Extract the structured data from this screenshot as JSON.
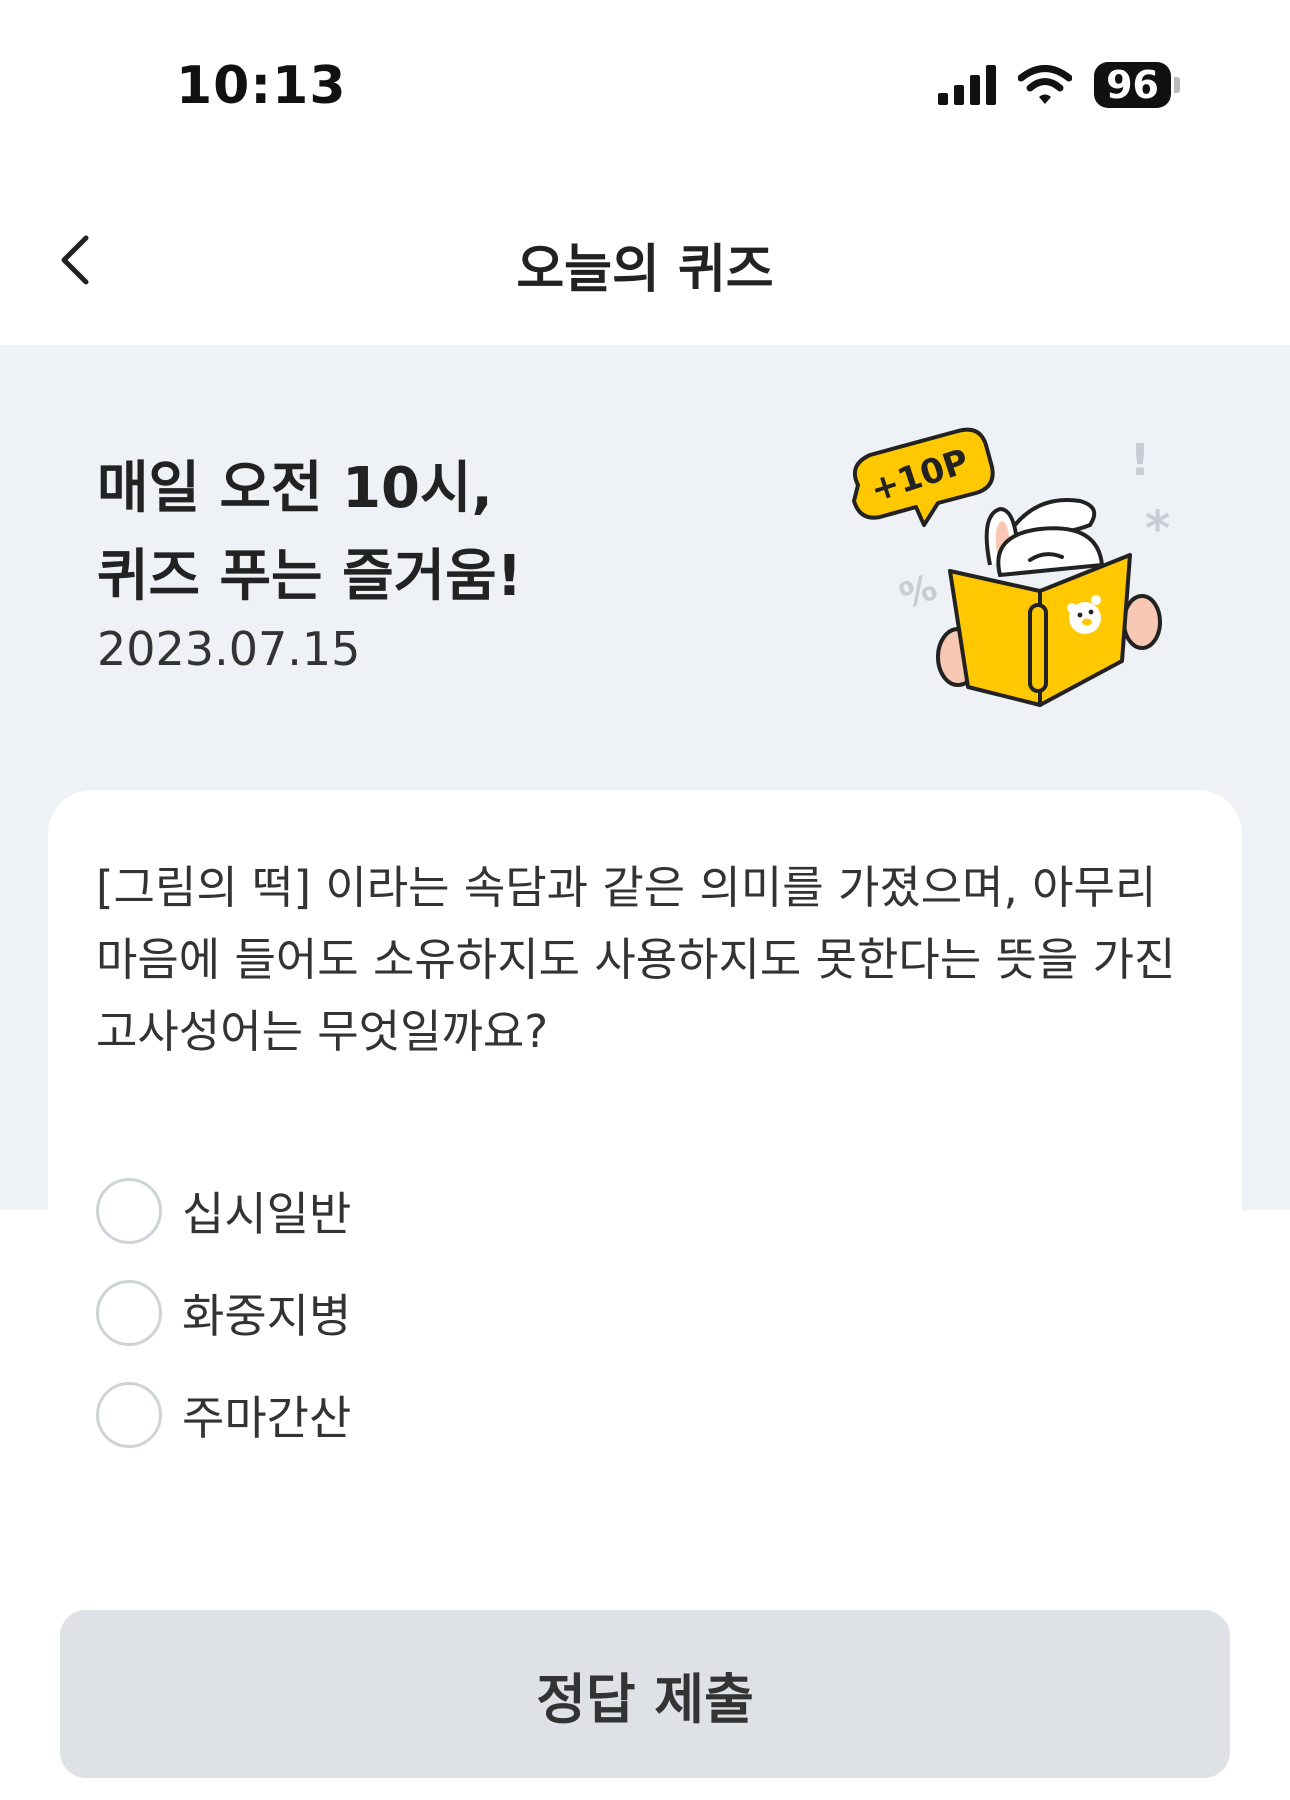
{
  "status_bar": {
    "time": "10:13",
    "battery": "96"
  },
  "header": {
    "title": "오늘의 퀴즈",
    "back_icon": "chevron-left-icon"
  },
  "hero": {
    "title_line1": "매일 오전 10시,",
    "title_line2": "퀴즈 푸는 즐거움!",
    "date": "2023.07.15",
    "badge": "+10P"
  },
  "quiz": {
    "question_line1": "[그림의 떡] 이라는 속담과 같은 의미를 가졌으며, 아무리",
    "question_line2": "마음에 들어도 소유하지도 사용하지도 못한다는 뜻을 가진",
    "question_line3": "고사성어는 무엇일까요?",
    "options": [
      {
        "label": "십시일반"
      },
      {
        "label": "화중지병"
      },
      {
        "label": "주마간산"
      }
    ]
  },
  "submit": {
    "label": "정답 제출"
  },
  "colors": {
    "hero_bg": "#eef1f5",
    "accent_yellow": "#ffc800",
    "button_bg": "#dee1e5"
  }
}
